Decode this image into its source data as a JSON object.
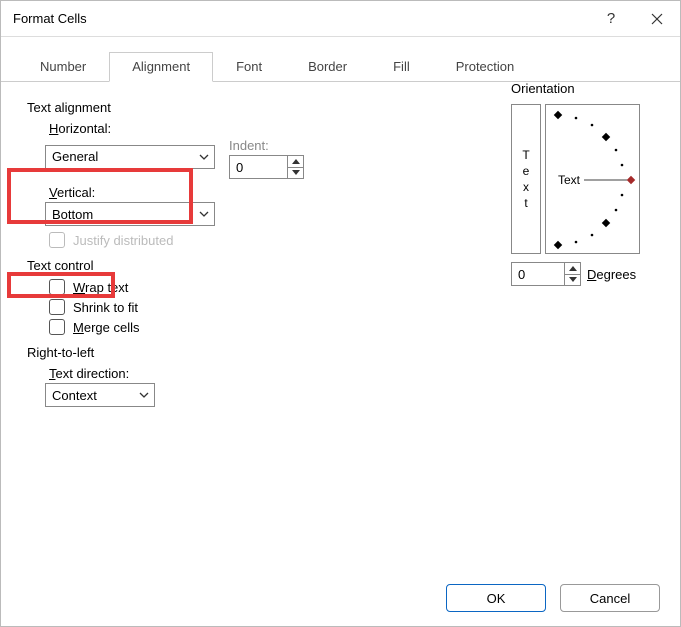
{
  "title": "Format Cells",
  "tabs": [
    "Number",
    "Alignment",
    "Font",
    "Border",
    "Fill",
    "Protection"
  ],
  "active_tab": "Alignment",
  "sections": {
    "text_alignment": "Text alignment",
    "text_control": "Text control",
    "rtl": "Right-to-left",
    "orientation": "Orientation"
  },
  "labels": {
    "horizontal": "Horizontal:",
    "vertical": "Vertical:",
    "indent": "Indent:",
    "text_direction": "Text direction:",
    "degrees": "Degrees",
    "orient_text": "Text",
    "orient_vert": [
      "T",
      "e",
      "x",
      "t"
    ]
  },
  "values": {
    "horizontal": "General",
    "vertical": "Bottom",
    "indent": "0",
    "text_direction": "Context",
    "degrees": "0"
  },
  "checkboxes": {
    "justify_distributed": "Justify distributed",
    "wrap_text": "Wrap text",
    "shrink_to_fit": "Shrink to fit",
    "merge_cells": "Merge cells"
  },
  "buttons": {
    "ok": "OK",
    "cancel": "Cancel"
  }
}
